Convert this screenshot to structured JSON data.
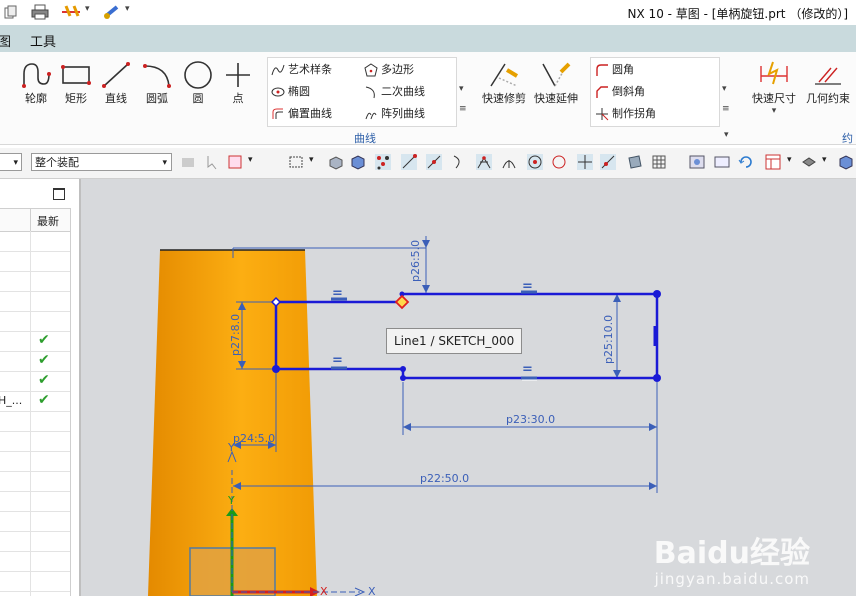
{
  "window": {
    "title": "NX 10 - 草图 - [单柄旋钮.prt （修改的）]"
  },
  "menu": {
    "items": [
      "图",
      "工具"
    ]
  },
  "ribbon": {
    "big_buttons": [
      "轮廓",
      "矩形",
      "直线",
      "圆弧",
      "圆",
      "点"
    ],
    "curve_col1": [
      "艺术样条",
      "椭圆",
      "偏置曲线"
    ],
    "curve_col2": [
      "多边形",
      "二次曲线",
      "阵列曲线"
    ],
    "group_label": "曲线",
    "edit_buttons": [
      "快速修剪",
      "快速延伸"
    ],
    "corner_col": [
      "圆角",
      "倒斜角",
      "制作拐角"
    ],
    "constraint_buttons": [
      "快速尺寸",
      "几何约束"
    ],
    "cut_label": "约"
  },
  "toolbar2": {
    "filter_value": "",
    "assembly_value": "整个装配"
  },
  "left_panel": {
    "column_header": "最新",
    "truncated_item": "H_...",
    "checked_rows": 4
  },
  "canvas": {
    "dimensions": [
      "p26:5.0",
      "p27:8.0",
      "p25:10.0",
      "p23:30.0",
      "p24:5.0",
      "p22:50.0"
    ],
    "equal_marker": "=",
    "axis_x": "X",
    "axis_y": "Y",
    "tooltip": "Line1 / SKETCH_000"
  },
  "colors": {
    "menubar_bg": "#c9dadd",
    "canvas_bg": "#d7d9dc",
    "part_orange": "#f7a008",
    "sketch_line": "#1a1ad6",
    "dimension": "#3b5fb8",
    "check_green": "#2e9e2e"
  },
  "watermark": {
    "brand": "Baidu经验",
    "url": "jingyan.baidu.com"
  }
}
